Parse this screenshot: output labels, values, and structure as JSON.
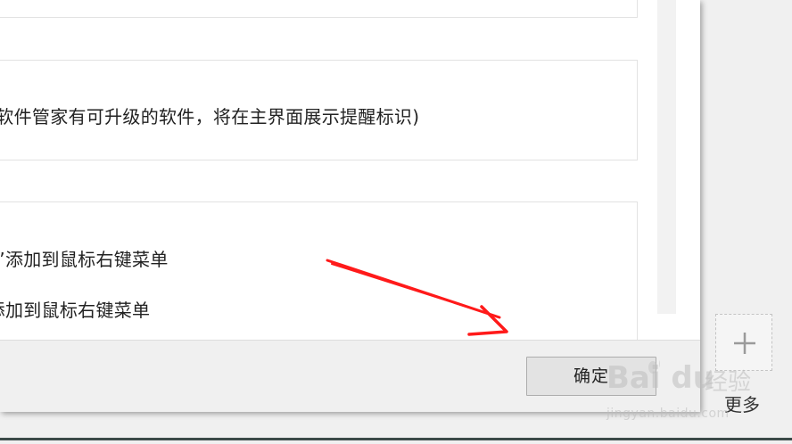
{
  "settings": {
    "upgrade_notice": "现软件管家有可升级的软件，将在主界面展示提醒标识)",
    "context_menu_item_1": "杀”添加到鼠标右键菜单",
    "context_menu_item_2": "”添加到鼠标右键菜单"
  },
  "footer": {
    "ok_label": "确定"
  },
  "side_panel": {
    "add_icon": "plus-icon",
    "more_label": "更多"
  },
  "annotation": {
    "arrow_color": "#ff0000"
  },
  "watermark": {
    "brand": "Bai du",
    "brand_cn": "经验",
    "url": "jingyan.baidu.com"
  }
}
